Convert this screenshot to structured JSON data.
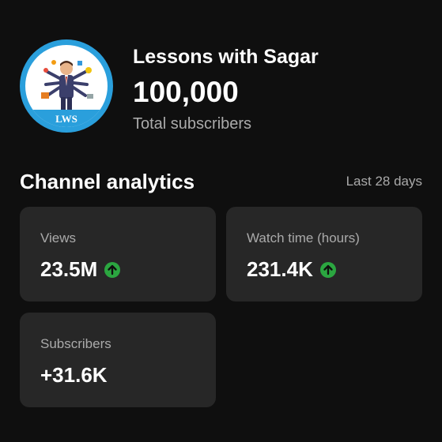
{
  "channel": {
    "name": "Lessons with Sagar",
    "subscriber_count": "100,000",
    "subscriber_label": "Total subscribers",
    "avatar_text": "LWS",
    "avatar_ring_color": "#2a9fdc"
  },
  "analytics": {
    "title": "Channel analytics",
    "period": "Last 28 days",
    "cards": [
      {
        "label": "Views",
        "value": "23.5M",
        "trend": "up",
        "icon": "arrow-up-circle-icon"
      },
      {
        "label": "Watch time (hours)",
        "value": "231.4K",
        "trend": "up",
        "icon": "arrow-up-circle-icon"
      },
      {
        "label": "Subscribers",
        "value": "+31.6K",
        "trend": "none"
      }
    ]
  },
  "colors": {
    "background": "#0f0f0f",
    "card": "#272727",
    "trend_up": "#2ba640",
    "secondary_text": "#aaaaaa"
  }
}
